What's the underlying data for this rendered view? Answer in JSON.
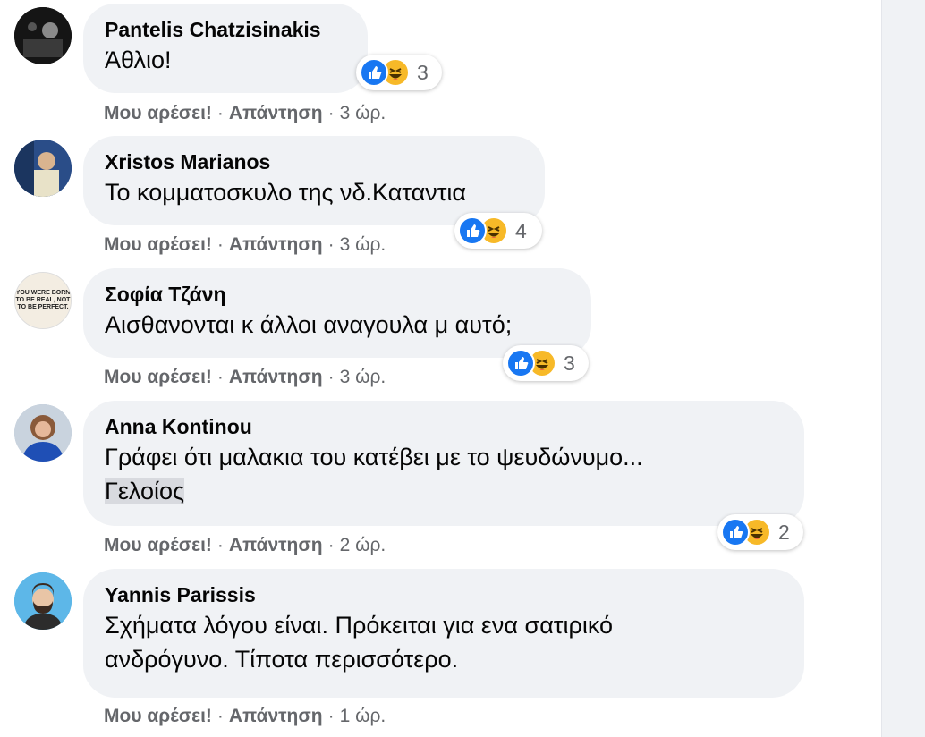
{
  "comments": [
    {
      "author": "Pantelis Chatzisinakis",
      "lines": [
        "Άθλιο!"
      ],
      "highlight": "",
      "actions": {
        "like": "Μου αρέσει!",
        "reply": "Απάντηση",
        "time": "3 ώρ."
      },
      "reactions": {
        "types": [
          "like-icon",
          "haha-icon"
        ],
        "count": "3"
      }
    },
    {
      "author": "Xristos Marianos",
      "lines": [
        "Το κομματοσκυλο της νδ.Καταντια"
      ],
      "highlight": "",
      "actions": {
        "like": "Μου αρέσει!",
        "reply": "Απάντηση",
        "time": "3 ώρ."
      },
      "reactions": {
        "types": [
          "like-icon",
          "haha-icon"
        ],
        "count": "4"
      }
    },
    {
      "author": "Σοφία Τζάνη",
      "avatar_text": "YOU WERE BORN TO BE REAL, NOT TO BE PERFECT.",
      "lines": [
        "Αισθανονται κ άλλοι αναγουλα μ αυτό;"
      ],
      "highlight": "",
      "actions": {
        "like": "Μου αρέσει!",
        "reply": "Απάντηση",
        "time": "3 ώρ."
      },
      "reactions": {
        "types": [
          "like-icon",
          "haha-icon"
        ],
        "count": "3"
      }
    },
    {
      "author": "Anna Kontinou",
      "lines": [
        "Γράφει ότι μαλακια του κατέβει με το ψευδώνυμο..."
      ],
      "highlight": "Γελοίος",
      "actions": {
        "like": "Μου αρέσει!",
        "reply": "Απάντηση",
        "time": "2 ώρ."
      },
      "reactions": {
        "types": [
          "like-icon",
          "haha-icon"
        ],
        "count": "2"
      }
    },
    {
      "author": "Yannis Parissis",
      "lines": [
        "Σχήματα λόγου είναι. Πρόκειται για ενα σατιρικό",
        "ανδρόγυνο. Τίποτα περισσότερο."
      ],
      "highlight": "",
      "actions": {
        "like": "Μου αρέσει!",
        "reply": "Απάντηση",
        "time": "1 ώρ."
      },
      "reactions": null
    }
  ]
}
